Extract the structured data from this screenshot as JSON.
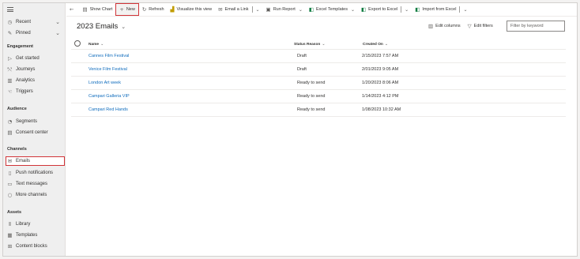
{
  "sidebar": {
    "top_items": [
      {
        "label": "Recent",
        "icon": "clock-icon"
      },
      {
        "label": "Pinned",
        "icon": "pin-icon"
      }
    ],
    "sections": [
      {
        "title": "Engagement",
        "items": [
          {
            "label": "Get started",
            "icon": "play-icon"
          },
          {
            "label": "Journeys",
            "icon": "journey-icon"
          },
          {
            "label": "Analytics",
            "icon": "analytics-icon"
          },
          {
            "label": "Triggers",
            "icon": "trigger-icon"
          }
        ]
      },
      {
        "title": "Audience",
        "items": [
          {
            "label": "Segments",
            "icon": "segments-icon"
          },
          {
            "label": "Consent center",
            "icon": "consent-icon"
          }
        ]
      },
      {
        "title": "Channels",
        "items": [
          {
            "label": "Emails",
            "icon": "mail-icon",
            "selected": true
          },
          {
            "label": "Push notifications",
            "icon": "push-icon"
          },
          {
            "label": "Text messages",
            "icon": "chat-icon"
          },
          {
            "label": "More channels",
            "icon": "channels-icon"
          }
        ]
      },
      {
        "title": "Assets",
        "items": [
          {
            "label": "Library",
            "icon": "library-icon"
          },
          {
            "label": "Templates",
            "icon": "templates-icon"
          },
          {
            "label": "Content blocks",
            "icon": "blocks-icon"
          }
        ]
      }
    ]
  },
  "toolbar": {
    "back_glyph": "←",
    "show_chart": "Show Chart",
    "new": "New",
    "refresh": "Refresh",
    "visualize": "Visualize this view",
    "email_link": "Email a Link",
    "run_report": "Run Report",
    "excel_templates": "Excel Templates",
    "export_excel": "Export to Excel",
    "import_excel": "Import from Excel"
  },
  "view": {
    "title": "2023 Emails",
    "edit_columns": "Edit columns",
    "edit_filters": "Edit filters",
    "filter_placeholder": "Filter by keyword"
  },
  "grid": {
    "columns": [
      {
        "label": "Name",
        "sort": "⌄"
      },
      {
        "label": "Status Reason",
        "sort": "⌄"
      },
      {
        "label": "Created On",
        "sort": "⌄"
      }
    ],
    "rows": [
      {
        "name": "Cannes Film Festival",
        "status": "Draft",
        "created": "2/15/2023 7:57 AM"
      },
      {
        "name": "Venice Film Festival",
        "status": "Draft",
        "created": "2/01/2023 9:05 AM"
      },
      {
        "name": "London Art week",
        "status": "Ready to send",
        "created": "1/20/2023 8:06 AM"
      },
      {
        "name": "Campari Galleria VIP",
        "status": "Ready to send",
        "created": "1/14/2023 4:12 PM"
      },
      {
        "name": "Campari Red Hands",
        "status": "Ready to send",
        "created": "1/08/2023 10:32 AM"
      }
    ]
  },
  "colors": {
    "link": "#0f6cbd",
    "highlight": "#d13438",
    "excel": "#107c41"
  }
}
